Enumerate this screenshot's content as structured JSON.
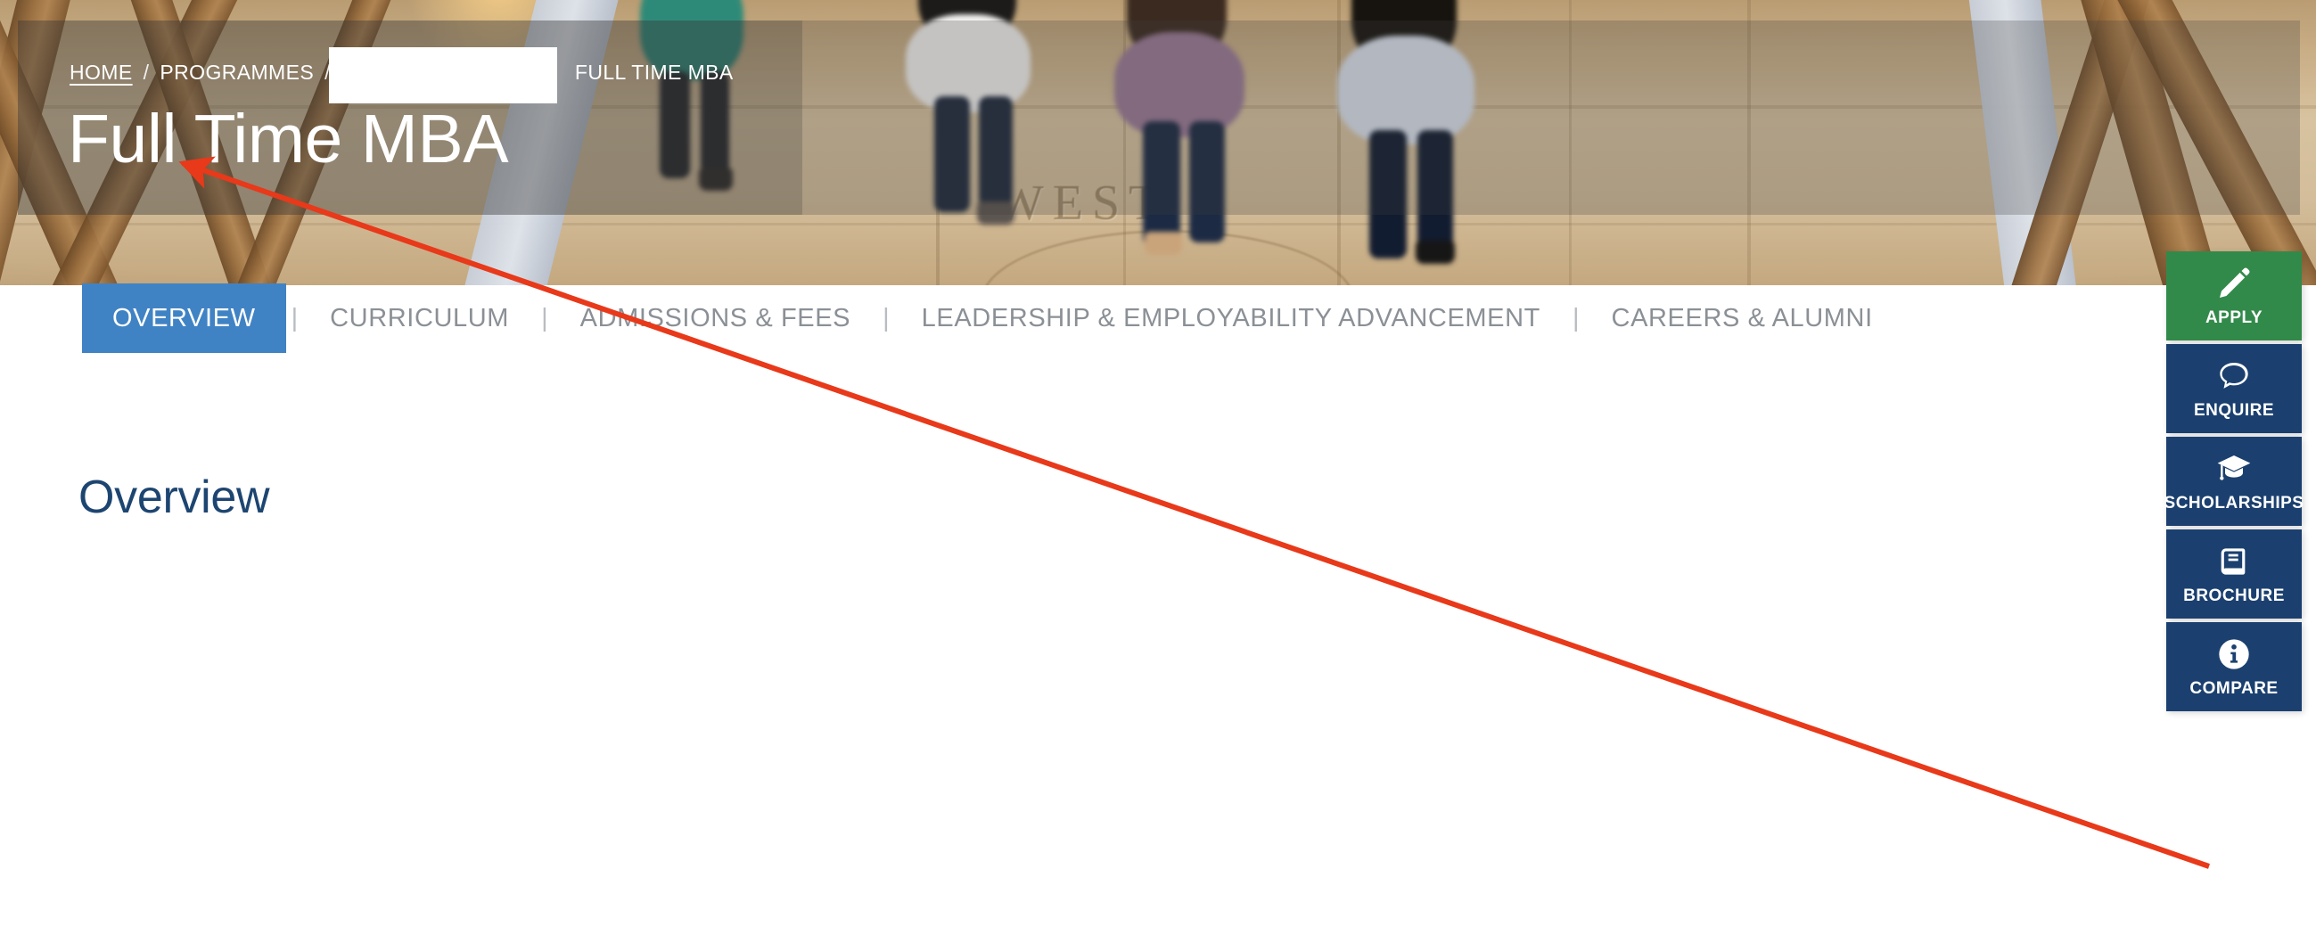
{
  "hero": {
    "title": "Full Time MBA",
    "background_engraving": "WEST",
    "breadcrumb": {
      "home_label": "HOME",
      "sep1": "/",
      "programmes_label": "PROGRAMMES",
      "sep2": "/",
      "redacted_label": "",
      "current_label": "FULL TIME MBA"
    }
  },
  "tabs": [
    {
      "label": "OVERVIEW",
      "active": true
    },
    {
      "label": "CURRICULUM",
      "active": false
    },
    {
      "label": "ADMISSIONS & FEES",
      "active": false
    },
    {
      "label": "LEADERSHIP & EMPLOYABILITY ADVANCEMENT",
      "active": false
    },
    {
      "label": "CAREERS & ALUMNI",
      "active": false
    }
  ],
  "tab_separator": "|",
  "main": {
    "section_title": "Overview",
    "body_text": ""
  },
  "rail": [
    {
      "label": "APPLY",
      "icon": "pencil-icon",
      "color": "#328a4a"
    },
    {
      "label": "ENQUIRE",
      "icon": "speech-bubble-icon",
      "color": "#1b406f"
    },
    {
      "label": "SCHOLARSHIPS",
      "icon": "graduation-cap-icon",
      "color": "#1b406f"
    },
    {
      "label": "BROCHURE",
      "icon": "book-icon",
      "color": "#1b406f"
    },
    {
      "label": "COMPARE",
      "icon": "info-circle-icon",
      "color": "#1b406f"
    }
  ],
  "colors": {
    "active_tab_blue": "#4083c4",
    "heading_navy": "#1d4571",
    "rail_navy": "#1b406f",
    "apply_green": "#328a4a",
    "annotation_red": "#e8391a",
    "tab_grey": "#8b9096"
  }
}
